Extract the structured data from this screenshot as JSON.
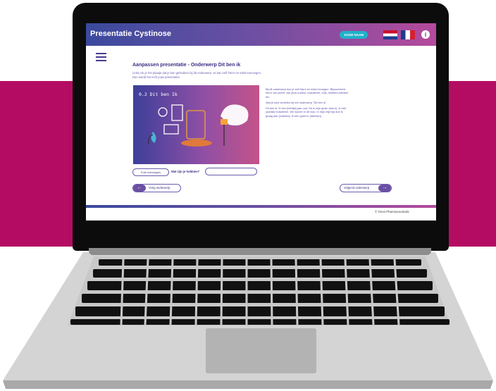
{
  "app": {
    "title": "Presentatie Cystinose",
    "user_button": "JOUW NAAM"
  },
  "page": {
    "title": "Aanpassen presentatie - Onderwerp Dit ben ik",
    "intro": "Links zie je het plaatje dat je kan gebruiken bij dit onderwerp. Je kan zelf foto's en tekst toevoegen. Dan wordt het echt jouw presentatie."
  },
  "slide": {
    "title": "0.2 Dit ben Ik"
  },
  "right_text": {
    "p1": "Bij dit onderwerp kun je zelf foto's en tekst invoegen. Bijvoorbeeld foto's van jezelf, van jouw ouders, huisdieren, huis, hobbies talenten etc.",
    "p2": "Wat je kunt vertellen bij het onderwerp \"Dit ben ik\"",
    "p3": "Dit ben ik. Ik ben (leeftijd) jaar oud. Dit is mijn gezin (foto's). Ik heb (aantal) huisdieren. We wonen in dit huis. In mijn vrije tijd doe ik graag aan (hobbies). Ik ben goed in (talenten)."
  },
  "controls": {
    "add_photo": "Foto toevoegen",
    "hobbies_label": "Wat zijn je hobbies?",
    "hobbies_value": "",
    "prev": "Vorig onderwerp",
    "next": "Volgend onderwerp"
  },
  "footer": {
    "copyright": "© Orexi Pharmaceuticals"
  },
  "colors": {
    "accent": "#b50c63",
    "brand_purple": "#3a2f83",
    "header_start": "#3a4a9e",
    "header_end": "#b54a9c"
  }
}
